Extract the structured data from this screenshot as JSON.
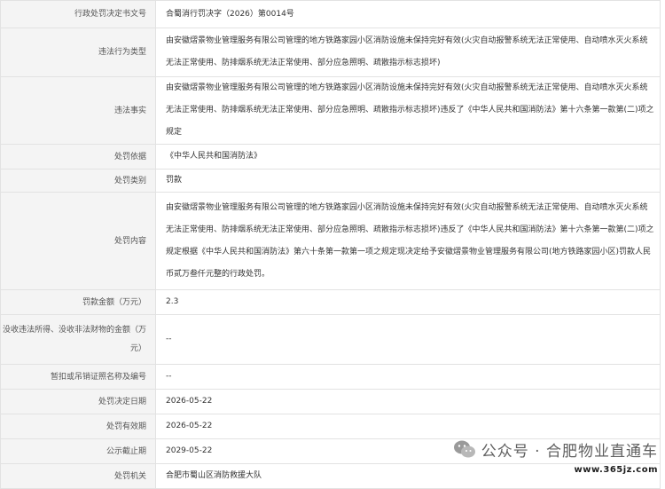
{
  "rows": [
    {
      "label": "行政处罚决定书文号",
      "value": "合蜀消行罚决字（2026）第0014号"
    },
    {
      "label": "违法行为类型",
      "value": "由安徽熠景物业管理服务有限公司管理的地方铁路家园小区消防设施未保持完好有效(火灾自动报警系统无法正常使用、自动喷水灭火系统无法正常使用、防排烟系统无法正常使用、部分应急照明、疏散指示标志损坏)"
    },
    {
      "label": "违法事实",
      "value": "由安徽熠景物业管理服务有限公司管理的地方铁路家园小区消防设施未保持完好有效(火灾自动报警系统无法正常使用、自动喷水灭火系统无法正常使用、防排烟系统无法正常使用、部分应急照明、疏散指示标志损坏)违反了《中华人民共和国消防法》第十六条第一款第(二)项之规定"
    },
    {
      "label": "处罚依据",
      "value": "《中华人民共和国消防法》"
    },
    {
      "label": "处罚类别",
      "value": "罚款"
    },
    {
      "label": "处罚内容",
      "value": "由安徽熠景物业管理服务有限公司管理的地方铁路家园小区消防设施未保持完好有效(火灾自动报警系统无法正常使用、自动喷水灭火系统无法正常使用、防排烟系统无法正常使用、部分应急照明、疏散指示标志损坏)违反了《中华人民共和国消防法》第十六条第一款第(二)项之规定根据《中华人民共和国消防法》第六十条第一款第一项之规定现决定给予安徽熠景物业管理服务有限公司(地方铁路家园小区)罚款人民币贰万叁仟元整的行政处罚。"
    },
    {
      "label": "罚款金额（万元）",
      "value": "2.3"
    },
    {
      "label": "没收违法所得、没收非法财物的金额（万元）",
      "value": "--"
    },
    {
      "label": "暂扣或吊销证照名称及编号",
      "value": "--"
    },
    {
      "label": "处罚决定日期",
      "value": "2026-05-22"
    },
    {
      "label": "处罚有效期",
      "value": "2026-05-22"
    },
    {
      "label": "公示截止期",
      "value": "2029-05-22"
    },
    {
      "label": "处罚机关",
      "value": "合肥市蜀山区消防救援大队"
    }
  ],
  "watermark": {
    "icon": "wechat-icon",
    "text": "公众号 · 合肥物业直通车",
    "url": "www.365jz.com"
  }
}
